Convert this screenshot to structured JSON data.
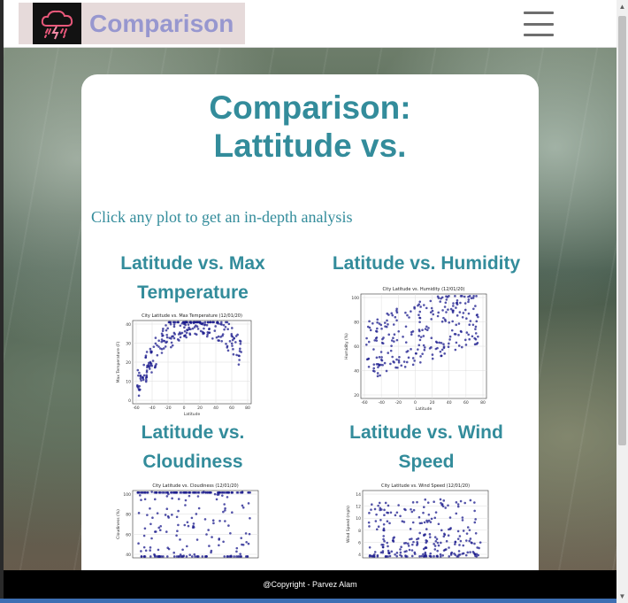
{
  "navbar": {
    "brand_text": "Comparison",
    "logo_icon": "storm-cloud-icon",
    "menu_icon": "hamburger-menu-icon"
  },
  "header": {
    "title_line1": "Comparison:",
    "title_line2": "Lattitude vs."
  },
  "intro_text": "Click any plot to get an in-depth analysis",
  "plots": [
    {
      "heading_line1": "Latitude vs. Max",
      "heading_line2": "Temperature",
      "image_title": "City Latitude vs. Max Temperature (12/01/20)",
      "ylabel": "Max Temperature (F)",
      "xlabel": "Latitude",
      "yticks": [
        "0",
        "10",
        "20",
        "30",
        "40"
      ],
      "xticks": [
        "-60",
        "-40",
        "-20",
        "0",
        "20",
        "40",
        "60",
        "80"
      ]
    },
    {
      "heading_line1": "Latitude vs. Humidity",
      "heading_line2": "",
      "image_title": "City Latitude vs. Humidity (12/01/20)",
      "ylabel": "Humidity (%)",
      "xlabel": "Latitude",
      "yticks": [
        "20",
        "40",
        "60",
        "80",
        "100"
      ],
      "xticks": [
        "-60",
        "-40",
        "-20",
        "0",
        "20",
        "40",
        "60",
        "80"
      ]
    },
    {
      "heading_line1": "Latitude vs.",
      "heading_line2": "Cloudiness",
      "image_title": "City Latitude vs. Cloudiness (12/01/20)",
      "ylabel": "Cloudiness (%)",
      "xlabel": "",
      "yticks": [
        "40",
        "60",
        "80",
        "100"
      ],
      "xticks": []
    },
    {
      "heading_line1": "Latitude vs. Wind",
      "heading_line2": "Speed",
      "image_title": "City Latitude vs. Wind Speed (12/01/20)",
      "ylabel": "Wind Speed (mph)",
      "xlabel": "",
      "yticks": [
        "4",
        "6",
        "8",
        "10",
        "12",
        "14"
      ],
      "xticks": []
    }
  ],
  "footer_text": "@Copyright - Parvez Alam",
  "colors": {
    "accent": "#338c9b",
    "brand": "#9797cf",
    "brand_bg": "#e6dada",
    "point": "#1a1a8c"
  }
}
